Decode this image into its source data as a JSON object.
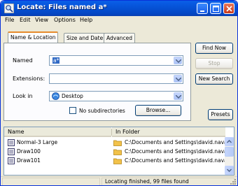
{
  "window": {
    "title": "Locate: Files named a*",
    "title_buttons": [
      "minimize-icon",
      "maximize-icon",
      "close-icon"
    ]
  },
  "menu": [
    "File",
    "Edit",
    "View",
    "Options",
    "Help"
  ],
  "tabs": [
    {
      "label": "Name & Location",
      "active": true
    },
    {
      "label": "Size and Date",
      "active": false
    },
    {
      "label": "Advanced",
      "active": false
    }
  ],
  "form": {
    "named_label": "Named",
    "named_value": "a*",
    "extensions_label": "Extensions:",
    "extensions_value": "",
    "lookin_label": "Look in",
    "lookin_value": "Desktop",
    "no_subdirs_label": "No subdirectories",
    "no_subdirs_checked": false,
    "browse_label": "Browse..."
  },
  "buttons": {
    "find_now": "Find Now",
    "stop": "Stop",
    "new_search": "New Search",
    "presets": "Presets"
  },
  "results": {
    "columns": [
      "Name",
      "In Folder"
    ],
    "rows": [
      {
        "name": "Normal-3 Large",
        "folder": "C:\\Documents and Settings\\david.navarr"
      },
      {
        "name": "Draw100",
        "folder": "C:\\Documents and Settings\\david.navarr"
      },
      {
        "name": "Draw101",
        "folder": "C:\\Documents and Settings\\david.navarr"
      }
    ]
  },
  "status": {
    "message": "Locating finished, 99 files found"
  },
  "colors": {
    "titlebar": "#0653d8",
    "active_tab_accent": "#e68b2c",
    "window_bg": "#ece9d8"
  }
}
